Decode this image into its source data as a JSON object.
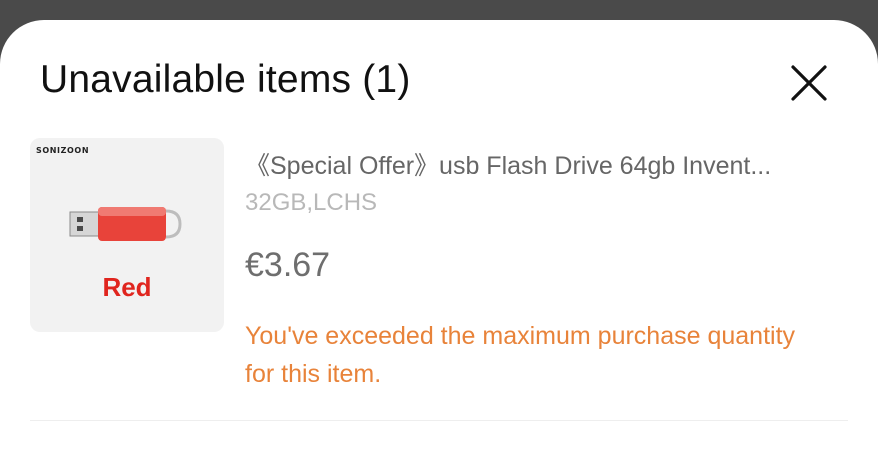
{
  "sheet": {
    "title": "Unavailable items (1)",
    "close_icon": "close-icon"
  },
  "item": {
    "thumbnail": {
      "brand": "SONIZOON",
      "color_label": "Red",
      "icon": "usb-flash-drive-icon"
    },
    "name": "《Special Offer》usb Flash Drive 64gb Invent...",
    "variant": "32GB,LCHS",
    "price": "€3.67",
    "warning": "You've exceeded the maximum purchase quantity for this item."
  },
  "colors": {
    "warning": "#e8833a",
    "product_red": "#e0251e",
    "price_gray": "#6e6e6e",
    "overlay": "#4a4a4a"
  }
}
